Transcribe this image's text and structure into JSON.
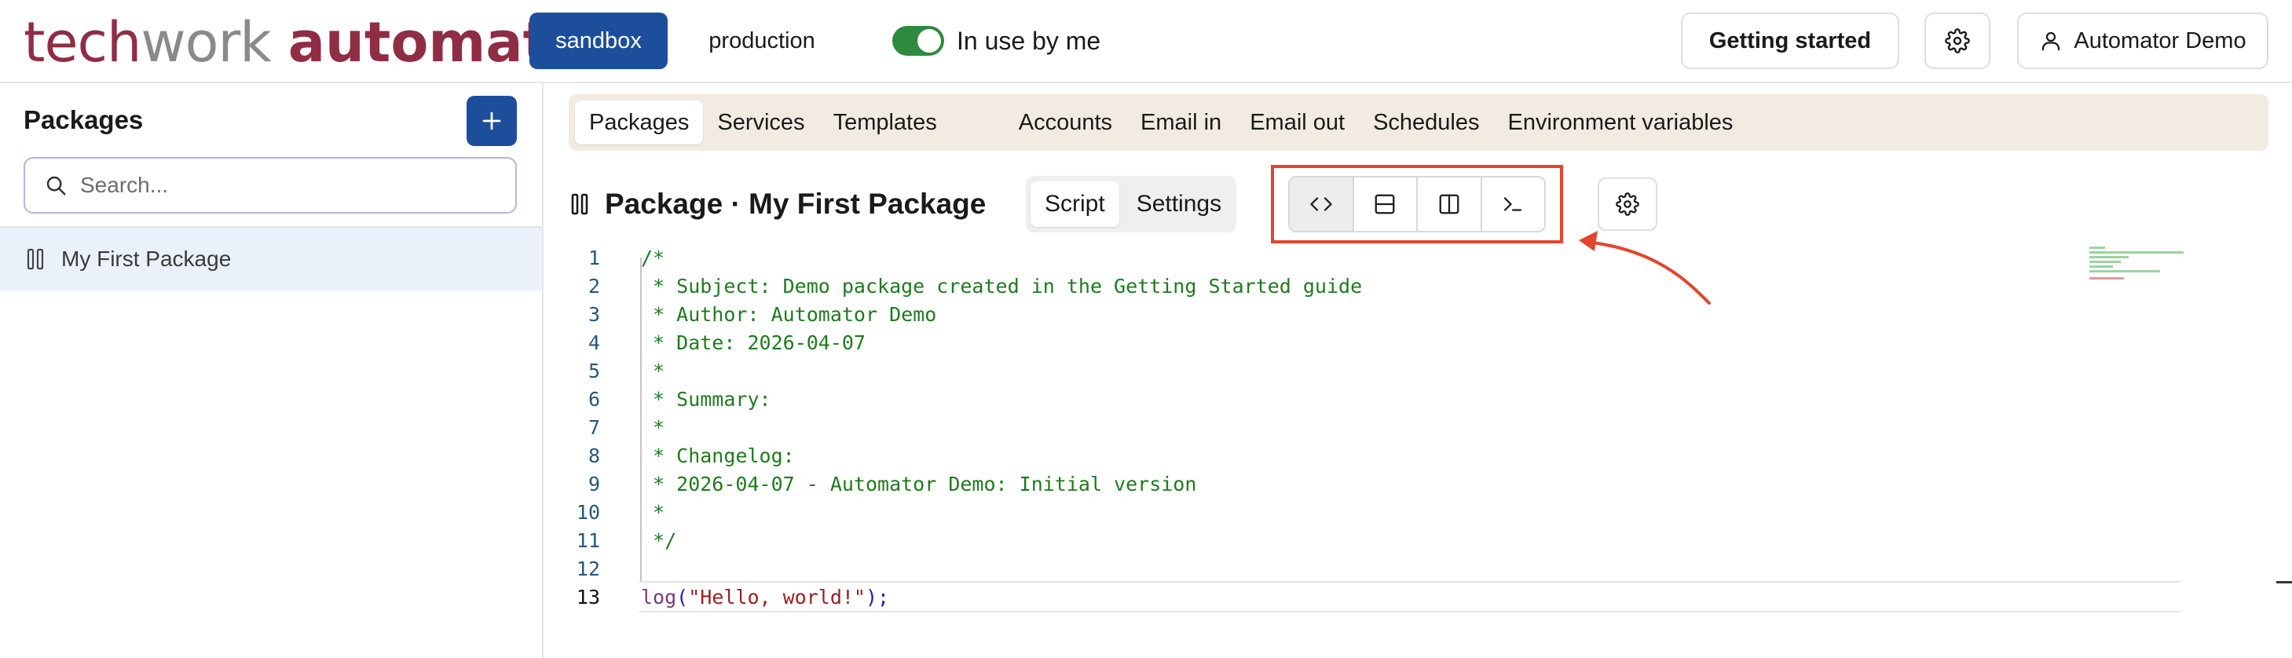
{
  "header": {
    "logo": {
      "part1": "tech",
      "part2": "work",
      "part3": "automator",
      "dot": "."
    },
    "environments": {
      "sandbox": "sandbox",
      "production": "production"
    },
    "in_use_toggle": {
      "label": "In use by me",
      "on": true
    },
    "getting_started_label": "Getting started",
    "user_label": "Automator Demo"
  },
  "sidebar": {
    "title": "Packages",
    "search_placeholder": "Search...",
    "items": [
      {
        "label": "My First Package"
      }
    ]
  },
  "main": {
    "tabs": [
      {
        "label": "Packages",
        "active": true
      },
      {
        "label": "Services"
      },
      {
        "label": "Templates"
      },
      {
        "label": "Accounts"
      },
      {
        "label": "Email in"
      },
      {
        "label": "Email out"
      },
      {
        "label": "Schedules"
      },
      {
        "label": "Environment variables"
      }
    ],
    "package_title": "Package · My First Package",
    "segment": {
      "script": "Script",
      "settings": "Settings"
    },
    "view_buttons": [
      "code-view-icon",
      "horizontal-split-icon",
      "vertical-split-icon",
      "terminal-icon"
    ]
  },
  "editor": {
    "lines": [
      {
        "n": "1",
        "text": "/*"
      },
      {
        "n": "2",
        "text": " * Subject: Demo package created in the Getting Started guide"
      },
      {
        "n": "3",
        "text": " * Author: Automator Demo"
      },
      {
        "n": "4",
        "text": " * Date: 2026-04-07"
      },
      {
        "n": "5",
        "text": " *"
      },
      {
        "n": "6",
        "text": " * Summary:"
      },
      {
        "n": "7",
        "text": " *"
      },
      {
        "n": "8",
        "text": " * Changelog:"
      },
      {
        "n": "9",
        "text": " * 2026-04-07 - Automator Demo: Initial version"
      },
      {
        "n": "10",
        "text": " *"
      },
      {
        "n": "11",
        "text": " */"
      },
      {
        "n": "12",
        "text": ""
      }
    ],
    "last_line": {
      "n": "13",
      "fn": "log",
      "open": "(",
      "str": "\"Hello, world!\"",
      "close": ");"
    }
  },
  "colors": {
    "primary": "#1d4e9c",
    "toggle_on": "#2e8a3c",
    "annotation": "#e2452b",
    "brand": "#8f2d45"
  }
}
